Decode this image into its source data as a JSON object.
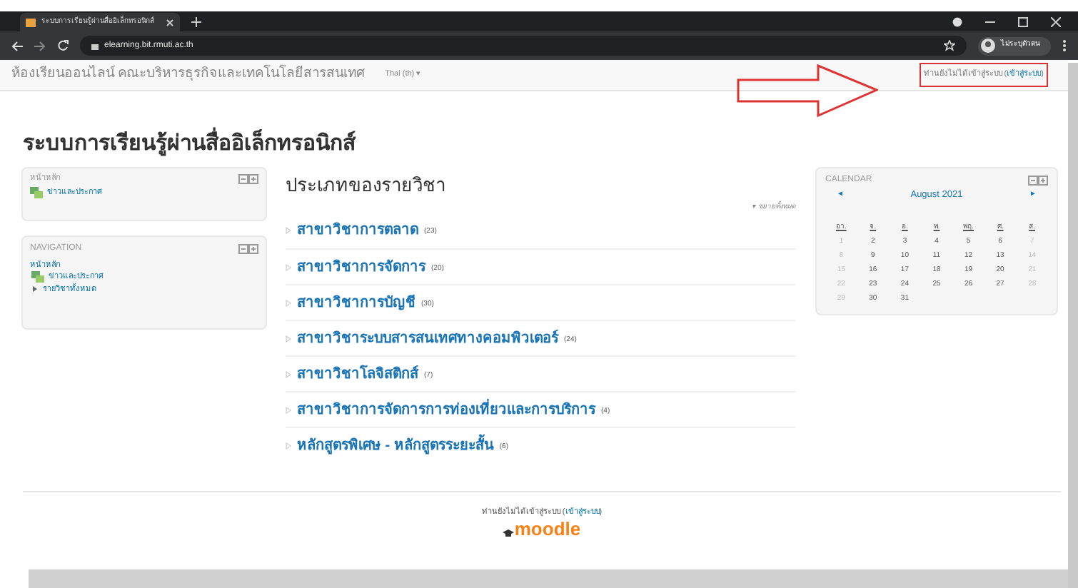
{
  "browser": {
    "tab_title": "ระบบการเรียนรู้ผ่านสื่ออิเล็กทรอนิกส์",
    "url": "elearning.bit.rmuti.ac.th",
    "profile": "ไม่ระบุตัวตน"
  },
  "navbar": {
    "site_name": "ห้องเรียนออนไลน์ คณะบริหารธุรกิจและเทคโนโลยีสารสนเทศ",
    "language": "Thai (th) ▾",
    "login_text": "ท่านยังไม่ได้เข้าสู่ระบบ (",
    "login_link": "เข้าสู่ระบบ",
    "login_close": ")"
  },
  "page_title": "ระบบการเรียนรู้ผ่านสื่ออิเล็กทรอนิกส์",
  "main_menu_block": {
    "title": "หน้าหลัก",
    "items": [
      "ข่าวและประกาศ"
    ]
  },
  "navigation_block": {
    "title": "NAVIGATION",
    "home": "หน้าหลัก",
    "items": [
      {
        "label": "ข่าวและประกาศ",
        "kind": "page"
      },
      {
        "label": "รายวิชาทั้งหมด",
        "kind": "branch"
      }
    ]
  },
  "categories": {
    "title": "ประเภทของรายวิชา",
    "expand_all": "▾ ขยายทั้งหมด",
    "items": [
      {
        "name": "สาขาวิชาการตลาด",
        "count": "(23)"
      },
      {
        "name": "สาขาวิชาการจัดการ",
        "count": "(20)"
      },
      {
        "name": "สาขาวิชาการบัญชี",
        "count": "(30)"
      },
      {
        "name": "สาขาวิชาระบบสารสนเทศทางคอมพิวเตอร์",
        "count": "(24)"
      },
      {
        "name": "สาขาวิชาโลจิสติกส์",
        "count": "(7)"
      },
      {
        "name": "สาขาวิชาการจัดการการท่องเที่ยวและการบริการ",
        "count": "(4)"
      },
      {
        "name": "หลักสูตรพิเศษ - หลักสูตรระยะสั้น",
        "count": "(6)"
      }
    ]
  },
  "calendar": {
    "title": "CALENDAR",
    "prev": "◄",
    "month": "August 2021",
    "next": "►",
    "weekdays": [
      "อา.",
      "จ.",
      "อ.",
      "พ.",
      "พฤ.",
      "ศ.",
      "ส."
    ],
    "weeks": [
      [
        {
          "day": "1",
          "weekend": true
        },
        {
          "day": "2",
          "weekend": false
        },
        {
          "day": "3",
          "weekend": false
        },
        {
          "day": "4",
          "weekend": false
        },
        {
          "day": "5",
          "weekend": false
        },
        {
          "day": "6",
          "weekend": false
        },
        {
          "day": "7",
          "weekend": true
        }
      ],
      [
        {
          "day": "8",
          "weekend": true
        },
        {
          "day": "9",
          "weekend": false
        },
        {
          "day": "10",
          "weekend": false
        },
        {
          "day": "11",
          "weekend": false
        },
        {
          "day": "12",
          "weekend": false
        },
        {
          "day": "13",
          "weekend": false
        },
        {
          "day": "14",
          "weekend": true
        }
      ],
      [
        {
          "day": "15",
          "weekend": true
        },
        {
          "day": "16",
          "weekend": false
        },
        {
          "day": "17",
          "weekend": false
        },
        {
          "day": "18",
          "weekend": false
        },
        {
          "day": "19",
          "weekend": false
        },
        {
          "day": "20",
          "weekend": false
        },
        {
          "day": "21",
          "weekend": true
        }
      ],
      [
        {
          "day": "22",
          "weekend": true
        },
        {
          "day": "23",
          "weekend": false
        },
        {
          "day": "24",
          "weekend": false
        },
        {
          "day": "25",
          "weekend": false
        },
        {
          "day": "26",
          "weekend": false
        },
        {
          "day": "27",
          "weekend": false
        },
        {
          "day": "28",
          "weekend": true
        }
      ],
      [
        {
          "day": "29",
          "weekend": true
        },
        {
          "day": "30",
          "weekend": false
        },
        {
          "day": "31",
          "weekend": false
        }
      ]
    ]
  },
  "footer": {
    "login_text": "ท่านยังไม่ได้เข้าสู่ระบบ (",
    "login_link": "เข้าสู่ระบบ",
    "login_close": ")",
    "logo": "moodle"
  }
}
